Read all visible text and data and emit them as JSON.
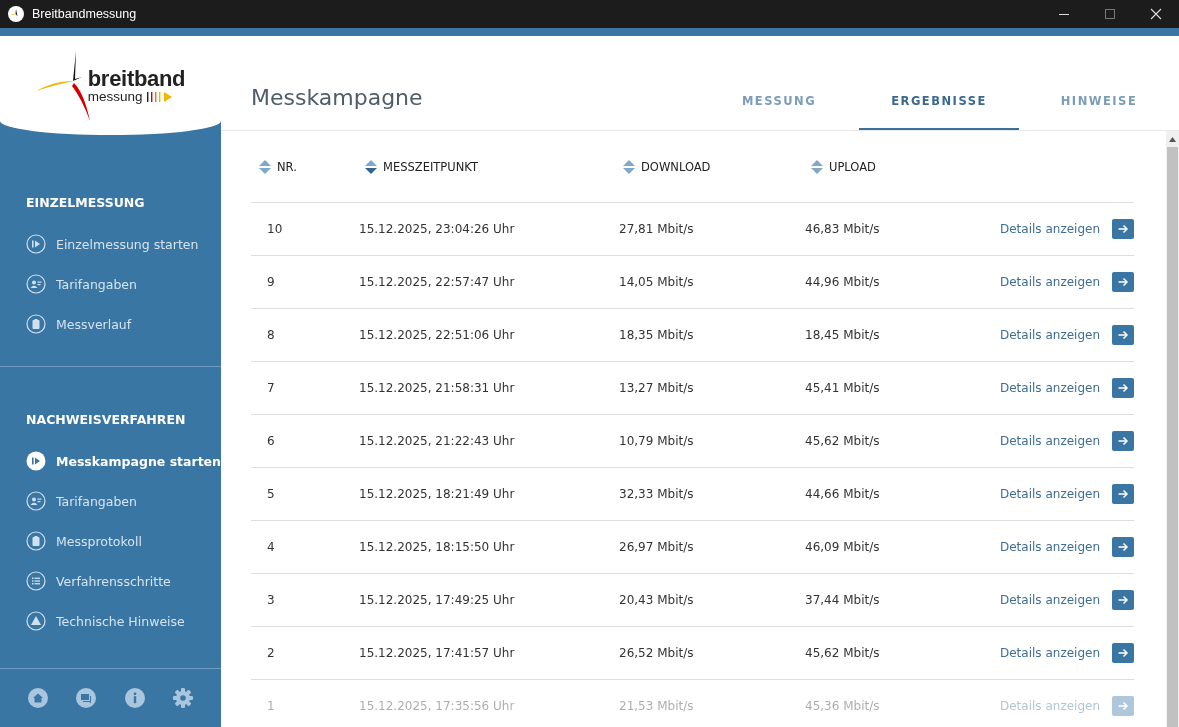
{
  "window": {
    "title": "Breitbandmessung"
  },
  "logo": {
    "word_1": "breitband",
    "word_2": "messung"
  },
  "sidebar": {
    "sections": [
      {
        "heading": "EINZELMESSUNG",
        "items": [
          {
            "label": "Einzelmessung starten",
            "kind": "play",
            "selected": false
          },
          {
            "label": "Tarifangaben",
            "kind": "person",
            "selected": false
          },
          {
            "label": "Messverlauf",
            "kind": "clipboard",
            "selected": false
          }
        ]
      },
      {
        "heading": "NACHWEISVERFAHREN",
        "items": [
          {
            "label": "Messkampagne starten",
            "kind": "play",
            "selected": true
          },
          {
            "label": "Tarifangaben",
            "kind": "person",
            "selected": false
          },
          {
            "label": "Messprotokoll",
            "kind": "clipboard",
            "selected": false
          },
          {
            "label": "Verfahrensschritte",
            "kind": "list",
            "selected": false
          },
          {
            "label": "Technische Hinweise",
            "kind": "warning",
            "selected": false
          }
        ]
      }
    ]
  },
  "page": {
    "title": "Messkampagne"
  },
  "tabs": [
    {
      "label": "MESSUNG",
      "selected": false
    },
    {
      "label": "ERGEBNISSE",
      "selected": true
    },
    {
      "label": "HINWEISE",
      "selected": false
    }
  ],
  "table": {
    "columns": [
      {
        "label": "NR.",
        "sorted": false
      },
      {
        "label": "MESSZEITPUNKT",
        "sorted": true
      },
      {
        "label": "DOWNLOAD",
        "sorted": false
      },
      {
        "label": "UPLOAD",
        "sorted": false
      }
    ],
    "rows": [
      {
        "nr": "10",
        "time": "15.12.2025, 23:04:26 Uhr",
        "download": "27,81 Mbit/s",
        "upload": "46,83 Mbit/s",
        "link": "Details anzeigen",
        "faded": false
      },
      {
        "nr": "9",
        "time": "15.12.2025, 22:57:47 Uhr",
        "download": "14,05 Mbit/s",
        "upload": "44,96 Mbit/s",
        "link": "Details anzeigen",
        "faded": false
      },
      {
        "nr": "8",
        "time": "15.12.2025, 22:51:06 Uhr",
        "download": "18,35 Mbit/s",
        "upload": "18,45 Mbit/s",
        "link": "Details anzeigen",
        "faded": false
      },
      {
        "nr": "7",
        "time": "15.12.2025, 21:58:31 Uhr",
        "download": "13,27 Mbit/s",
        "upload": "45,41 Mbit/s",
        "link": "Details anzeigen",
        "faded": false
      },
      {
        "nr": "6",
        "time": "15.12.2025, 21:22:43 Uhr",
        "download": "10,79 Mbit/s",
        "upload": "45,62 Mbit/s",
        "link": "Details anzeigen",
        "faded": false
      },
      {
        "nr": "5",
        "time": "15.12.2025, 18:21:49 Uhr",
        "download": "32,33 Mbit/s",
        "upload": "44,66 Mbit/s",
        "link": "Details anzeigen",
        "faded": false
      },
      {
        "nr": "4",
        "time": "15.12.2025, 18:15:50 Uhr",
        "download": "26,97 Mbit/s",
        "upload": "46,09 Mbit/s",
        "link": "Details anzeigen",
        "faded": false
      },
      {
        "nr": "3",
        "time": "15.12.2025, 17:49:25 Uhr",
        "download": "20,43 Mbit/s",
        "upload": "37,44 Mbit/s",
        "link": "Details anzeigen",
        "faded": false
      },
      {
        "nr": "2",
        "time": "15.12.2025, 17:41:57 Uhr",
        "download": "26,52 Mbit/s",
        "upload": "45,62 Mbit/s",
        "link": "Details anzeigen",
        "faded": false
      },
      {
        "nr": "1",
        "time": "15.12.2025, 17:35:56 Uhr",
        "download": "21,53 Mbit/s",
        "upload": "45,36 Mbit/s",
        "link": "Details anzeigen",
        "faded": true
      }
    ]
  }
}
